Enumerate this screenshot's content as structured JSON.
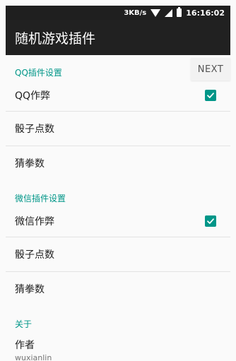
{
  "status_bar": {
    "speed": "3KB/s",
    "time": "16:16:02",
    "icons": [
      "wifi-icon",
      "signal-icon",
      "battery-icon"
    ]
  },
  "app_bar": {
    "title": "随机游戏插件"
  },
  "next_button": {
    "label": "NEXT"
  },
  "sections": {
    "qq": {
      "title": "QQ插件设置",
      "cheat_label": "QQ作弊",
      "cheat_checked": true,
      "dice_label": "骰子点数",
      "rps_label": "猜拳数"
    },
    "wechat": {
      "title": "微信插件设置",
      "cheat_label": "微信作弊",
      "cheat_checked": true,
      "dice_label": "骰子点数",
      "rps_label": "猜拳数"
    },
    "about": {
      "title": "关于",
      "author_label": "作者",
      "author_value": "wuxianlin"
    }
  },
  "colors": {
    "accent": "#009688",
    "app_bar": "#212121",
    "status_bar": "#1f1f1f"
  }
}
